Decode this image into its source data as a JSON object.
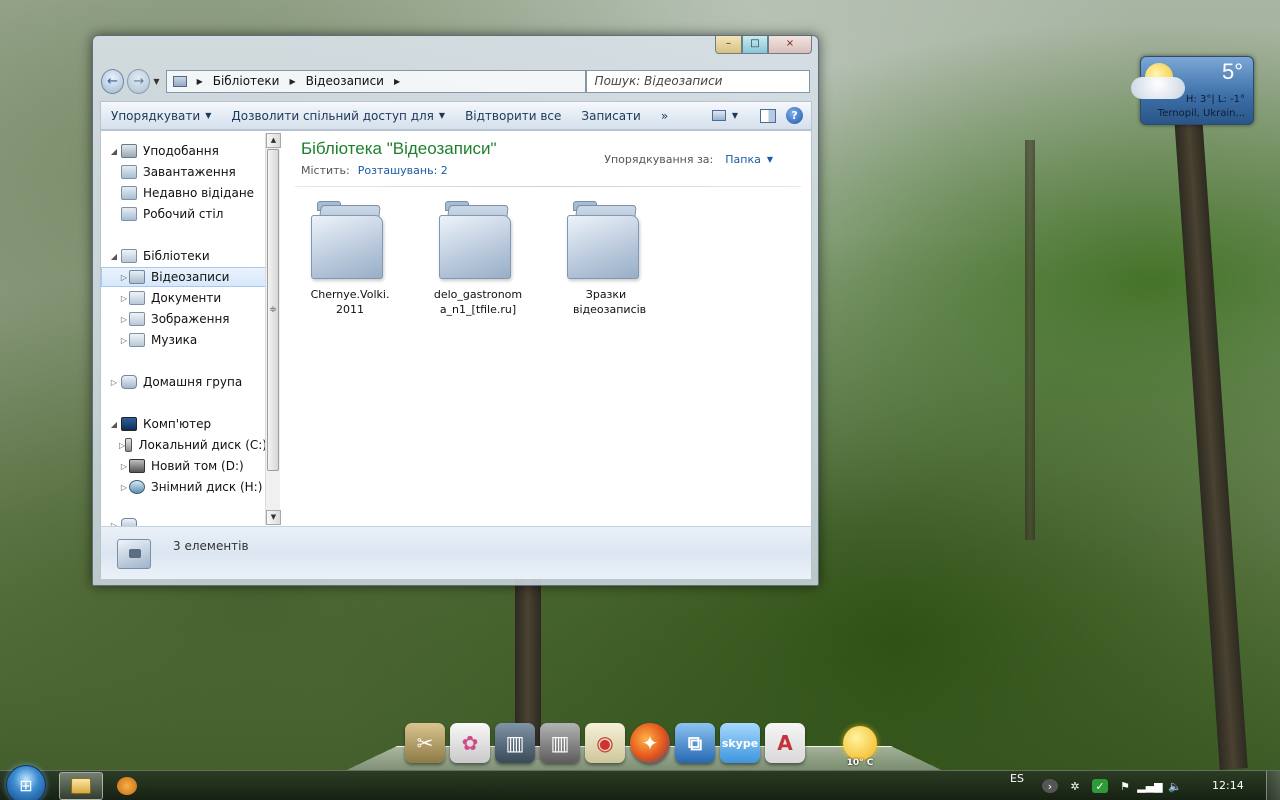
{
  "window": {
    "caption_buttons": {
      "minimize": "–",
      "maximize": "□",
      "close": "×"
    },
    "breadcrumb": [
      "Бібліотеки",
      "Відеозаписи"
    ],
    "search_placeholder": "Пошук: Відеозаписи",
    "toolbar": {
      "organize": "Упорядкувати",
      "share": "Дозволити спільний доступ для",
      "play_all": "Відтворити все",
      "burn": "Записати",
      "more": "»"
    },
    "nav_tree": [
      {
        "label": "Уподобання",
        "level": 0,
        "icon": "star-icon",
        "expanded": true
      },
      {
        "label": "Завантаження",
        "level": 1,
        "icon": "downloads-icon"
      },
      {
        "label": "Недавно відідане",
        "level": 1,
        "icon": "recent-places-icon"
      },
      {
        "label": "Робочий стіл",
        "level": 1,
        "icon": "desktop-icon"
      },
      {
        "label": "Бібліотеки",
        "level": 0,
        "icon": "library-icon",
        "expanded": true
      },
      {
        "label": "Відеозаписи",
        "level": 1,
        "icon": "videos-icon",
        "selected": true
      },
      {
        "label": "Документи",
        "level": 1,
        "icon": "documents-icon"
      },
      {
        "label": "Зображення",
        "level": 1,
        "icon": "pictures-icon"
      },
      {
        "label": "Музика",
        "level": 1,
        "icon": "music-icon"
      },
      {
        "label": "Домашня група",
        "level": 0,
        "icon": "homegroup-icon"
      },
      {
        "label": "Комп'ютер",
        "level": 0,
        "icon": "computer-icon",
        "expanded": true
      },
      {
        "label": "Локальний диск (C:)",
        "level": 1,
        "icon": "local-disk-icon"
      },
      {
        "label": "Новий том (D:)",
        "level": 1,
        "icon": "volume-disk-icon"
      },
      {
        "label": "Знімний диск (H:)",
        "level": 1,
        "icon": "removable-disk-icon"
      }
    ],
    "library": {
      "title": "Бібліотека \"Відеозаписи\"",
      "contains_label": "Містить:",
      "locations_link": "Розташувань: 2",
      "arrange_label": "Упорядкування за:",
      "arrange_value": "Папка"
    },
    "files": [
      {
        "name": "Chernye.Volki.2011",
        "icon": "folder-icon"
      },
      {
        "name": "delo_gastronoma_n1_[tfile.ru]",
        "icon": "folder-icon"
      },
      {
        "name": "Зразки відеозаписів",
        "icon": "folder-icon"
      }
    ],
    "details": {
      "item_count": "3 елементів"
    }
  },
  "weather_gadget": {
    "temperature": "5°",
    "high_low": "H: 3°| L: -1°",
    "location": "Ternopil, Ukrain..."
  },
  "dock": {
    "items": [
      {
        "name": "tools-icon",
        "color": "#b9a36a"
      },
      {
        "name": "photos-icon",
        "color": "#e9e9e9"
      },
      {
        "name": "trash-full-icon",
        "color": "#5b6d7c"
      },
      {
        "name": "trash-empty-icon",
        "color": "#8a8a8a"
      },
      {
        "name": "paint-palette-icon",
        "color": "#e8e3c3"
      },
      {
        "name": "firefox-icon",
        "color": "#e66b1f"
      },
      {
        "name": "mail-icon",
        "color": "#3a86c9"
      },
      {
        "name": "skype-icon",
        "color": "#5eb2ea"
      },
      {
        "name": "adobe-icon",
        "color": "#c5333a"
      }
    ],
    "weather_text": "10° C"
  },
  "taskbar": {
    "language": "ES",
    "clock": "12:14"
  }
}
